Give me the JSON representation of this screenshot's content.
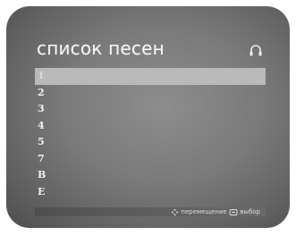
{
  "title": "список песен",
  "icons": {
    "top_right": "headphones-icon",
    "navigate": "dpad-icon",
    "select": "select-icon"
  },
  "colors": {
    "selection": "#b9b9b9",
    "text": "#f2f2f2"
  },
  "songs": [
    "1",
    "2",
    "3",
    "4",
    "5",
    "7",
    "B",
    "E"
  ],
  "selected_index": 0,
  "footer": {
    "navigate_label": "перемещение",
    "select_label": "выбор"
  }
}
